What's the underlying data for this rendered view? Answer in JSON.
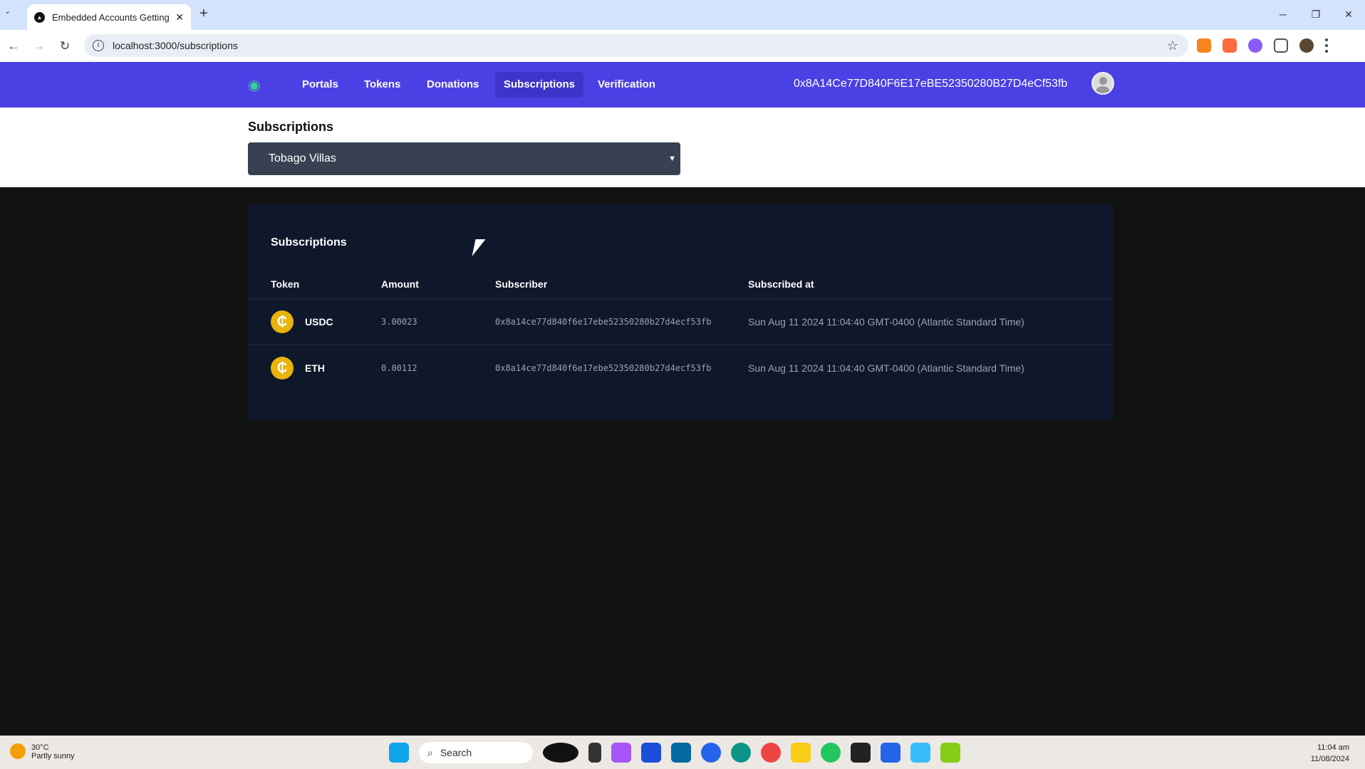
{
  "browser": {
    "tab_title": "Embedded Accounts Getting Started",
    "url": "localhost:3000/subscriptions"
  },
  "nav": {
    "items": [
      {
        "label": "Portals"
      },
      {
        "label": "Tokens"
      },
      {
        "label": "Donations"
      },
      {
        "label": "Subscriptions",
        "active": true
      },
      {
        "label": "Verification"
      }
    ],
    "wallet": "0x8A14Ce77D840F6E17eBE52350280B27D4eCf53fb",
    "accent": "#4b40e3"
  },
  "page": {
    "title": "Subscriptions",
    "select_value": "Tobago Villas"
  },
  "table": {
    "title": "Subscriptions",
    "headers": [
      "Token",
      "Amount",
      "Subscriber",
      "Subscribed at"
    ],
    "rows": [
      {
        "token": "USDC",
        "amount": "3.00023",
        "subscriber": "0x8a14ce77d840f6e17ebe52350280b27d4ecf53fb",
        "date": "Sun Aug 11 2024 11:04:40 GMT-0400 (Atlantic Standard Time)"
      },
      {
        "token": "ETH",
        "amount": "0.00112",
        "subscriber": "0x8a14ce77d840f6e17ebe52350280b27d4ecf53fb",
        "date": "Sun Aug 11 2024 11:04:40 GMT-0400 (Atlantic Standard Time)"
      }
    ]
  },
  "taskbar": {
    "temp": "30°C",
    "weather": "Partly sunny",
    "search": "Search",
    "time": "11:04 am",
    "date": "11/08/2024"
  }
}
